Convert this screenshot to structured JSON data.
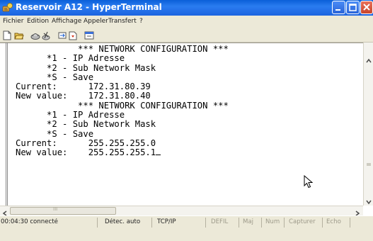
{
  "window": {
    "title": "Reservoir A12 - HyperTerminal"
  },
  "menu": [
    "Fichier",
    "Edition",
    "Affichage",
    "Appeler",
    "Transfert",
    "?"
  ],
  "toolbar": {
    "icons": [
      "new-icon",
      "open-icon",
      "connect-icon",
      "disconnect-icon",
      "send-icon",
      "receive-icon",
      "properties-icon"
    ]
  },
  "terminal": {
    "lines": [
      "            *** NETWORK CONFIGURATION ***",
      "",
      "      *1 - IP Adresse",
      "      *2 - Sub Network Mask",
      "      *S - Save",
      "Current:      172.31.80.39",
      "New value:    172.31.80.40",
      "            *** NETWORK CONFIGURATION ***",
      "",
      "      *1 - IP Adresse",
      "      *2 - Sub Network Mask",
      "      *S - Save",
      "Current:      255.255.255.0",
      "New value:    255.255.255.1"
    ]
  },
  "hscroll": {
    "grip_label": "III"
  },
  "status": {
    "connected": "00:04:30 connecté",
    "detect": "Détec. auto",
    "protocol": "TCP/IP",
    "scroll": "DÉFIL",
    "caps": "Maj",
    "num": "Num",
    "capture": "Capturer",
    "echo": "Écho"
  },
  "colors": {
    "titlebar": "#1c63e0",
    "terminal_bg": "#ffffff",
    "terminal_text": "#000000"
  }
}
